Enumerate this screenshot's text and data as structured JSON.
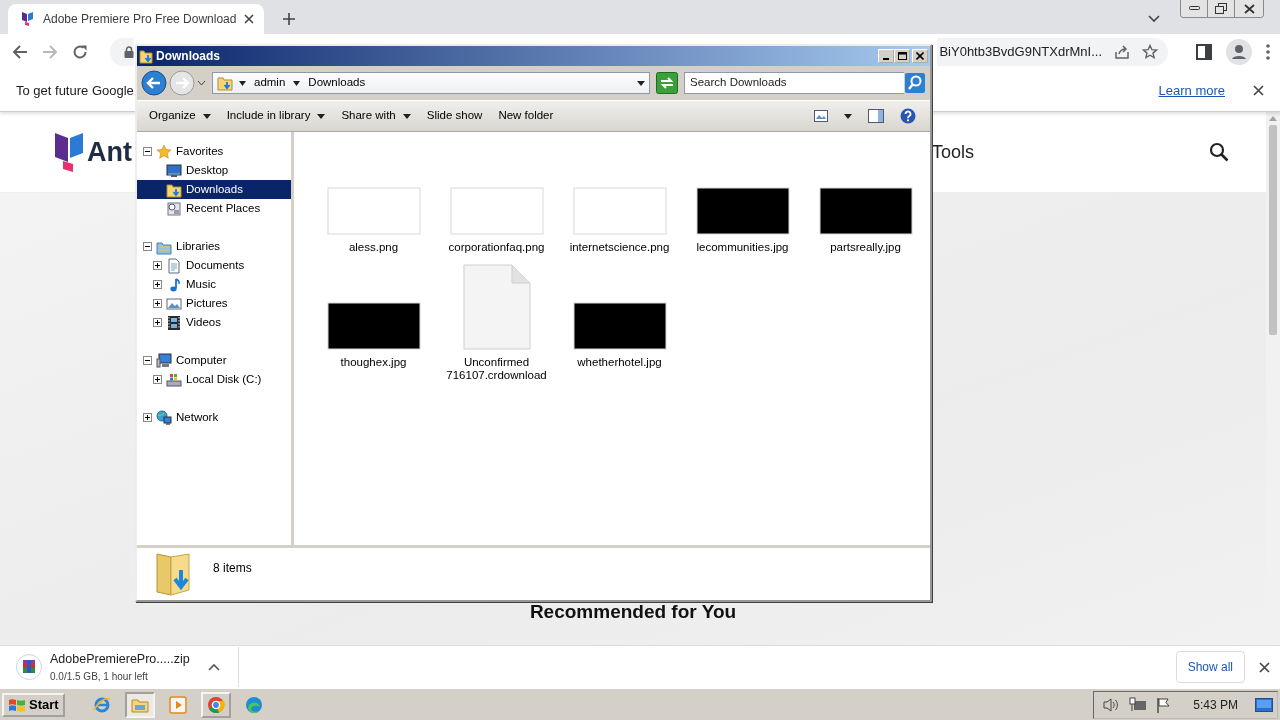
{
  "browser": {
    "tab": {
      "title": "Adobe Premiere Pro Free Download"
    },
    "address": "BiY0htb3BvdG9NTXdrMnI...",
    "infobar": {
      "message": "To get future Google",
      "link": "Learn more"
    },
    "page": {
      "logo_text": "Ant",
      "nav_item": "Tools",
      "heading": "Recommended for You"
    },
    "download": {
      "filename": "AdobePremierePro.....zip",
      "status": "0.0/1.5 GB, 1 hour left",
      "show_all": "Show all"
    }
  },
  "explorer": {
    "title": "Downloads",
    "breadcrumb": [
      "admin",
      "Downloads"
    ],
    "search": {
      "placeholder": "Search Downloads"
    },
    "commands": [
      {
        "label": "Organize",
        "dropdown": true
      },
      {
        "label": "Include in library",
        "dropdown": true
      },
      {
        "label": "Share with",
        "dropdown": true
      },
      {
        "label": "Slide show",
        "dropdown": false
      },
      {
        "label": "New folder",
        "dropdown": false
      }
    ],
    "tree": [
      {
        "label": "Favorites",
        "kind": "favorites",
        "expanded": true,
        "selected": false,
        "children": [
          {
            "label": "Desktop",
            "kind": "desktop",
            "selected": false
          },
          {
            "label": "Downloads",
            "kind": "downloads",
            "selected": true
          },
          {
            "label": "Recent Places",
            "kind": "places",
            "selected": false
          }
        ]
      },
      {
        "label": "Libraries",
        "kind": "library",
        "expanded": true,
        "selected": false,
        "children": [
          {
            "label": "Documents",
            "kind": "documents",
            "expanded": false,
            "selected": false
          },
          {
            "label": "Music",
            "kind": "music",
            "expanded": false,
            "selected": false
          },
          {
            "label": "Pictures",
            "kind": "pictures",
            "expanded": false,
            "selected": false
          },
          {
            "label": "Videos",
            "kind": "videos",
            "expanded": false,
            "selected": false
          }
        ]
      },
      {
        "label": "Computer",
        "kind": "computer",
        "expanded": true,
        "selected": false,
        "children": [
          {
            "label": "Local Disk (C:)",
            "kind": "disk",
            "expanded": false,
            "selected": false
          }
        ]
      },
      {
        "label": "Network",
        "kind": "network",
        "expanded": false,
        "selected": false
      }
    ],
    "files": [
      {
        "name": "aless.png",
        "kind": "light"
      },
      {
        "name": "corporationfaq.png",
        "kind": "light"
      },
      {
        "name": "internetscience.png",
        "kind": "light"
      },
      {
        "name": "lecommunities.jpg",
        "kind": "dark"
      },
      {
        "name": "partsreally.jpg",
        "kind": "dark"
      },
      {
        "name": "thoughex.jpg",
        "kind": "dark"
      },
      {
        "name": "Unconfirmed 716107.crdownload",
        "kind": "file"
      },
      {
        "name": "whetherhotel.jpg",
        "kind": "dark"
      }
    ],
    "status": "8 items"
  },
  "taskbar": {
    "start": "Start",
    "apps": [
      {
        "kind": "ie",
        "running": false,
        "active": false
      },
      {
        "kind": "explorer",
        "running": true,
        "active": true
      },
      {
        "kind": "media",
        "running": false,
        "active": false
      },
      {
        "kind": "chrome",
        "running": true,
        "active": false
      },
      {
        "kind": "edge",
        "running": false,
        "active": false
      }
    ],
    "clock": "5:43 PM"
  }
}
